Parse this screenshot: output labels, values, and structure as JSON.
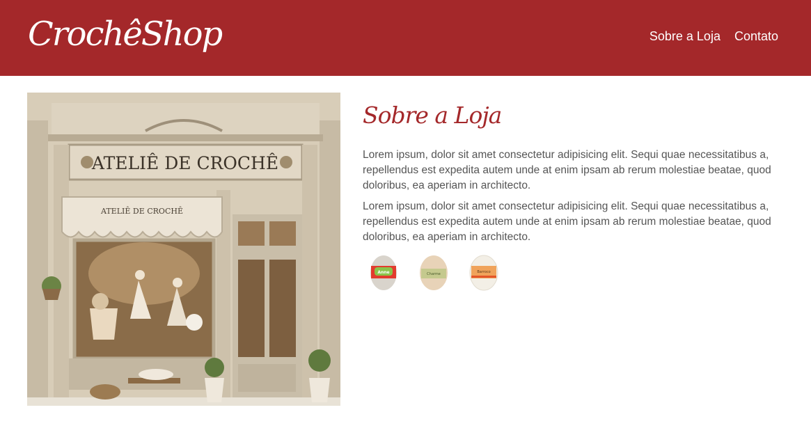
{
  "header": {
    "logo_text": "CrochêShop",
    "nav": [
      {
        "label": "Sobre a Loja"
      },
      {
        "label": "Contato"
      }
    ]
  },
  "hero_image": {
    "sign_text": "ATELIÊ DE CROCHÊ",
    "awning_text": "ATELIÊ DE CROCHÊ"
  },
  "about": {
    "title": "Sobre a Loja",
    "paragraphs": [
      "Lorem ipsum, dolor sit amet consectetur adipisicing elit. Sequi quae necessitatibus a, repellendus est expedita autem unde at enim ipsam ab rerum molestiae beatae, quod doloribus, ea aperiam in architecto.",
      "Lorem ipsum, dolor sit amet consectetur adipisicing elit. Sequi quae necessitatibus a, repellendus est expedita autem unde at enim ipsam ab rerum molestiae beatae, quod doloribus, ea aperiam in architecto."
    ]
  },
  "products": [
    {
      "label": "Anne",
      "icon": "yarn-ball-icon",
      "band_color": "#e23b2e",
      "label_color": "#8bc34a",
      "yarn_color": "#d9d4cc"
    },
    {
      "label": "Charme",
      "icon": "yarn-ball-icon",
      "band_color": "#a7b27c",
      "label_color": "#c5c98e",
      "yarn_color": "#e8d3b8"
    },
    {
      "label": "Barroco",
      "icon": "yarn-ball-icon",
      "band_color": "#e4562a",
      "label_color": "#f0a35b",
      "yarn_color": "#f3efe6"
    }
  ],
  "colors": {
    "brand": "#a4282a",
    "text": "#555555",
    "background": "#ffffff"
  }
}
